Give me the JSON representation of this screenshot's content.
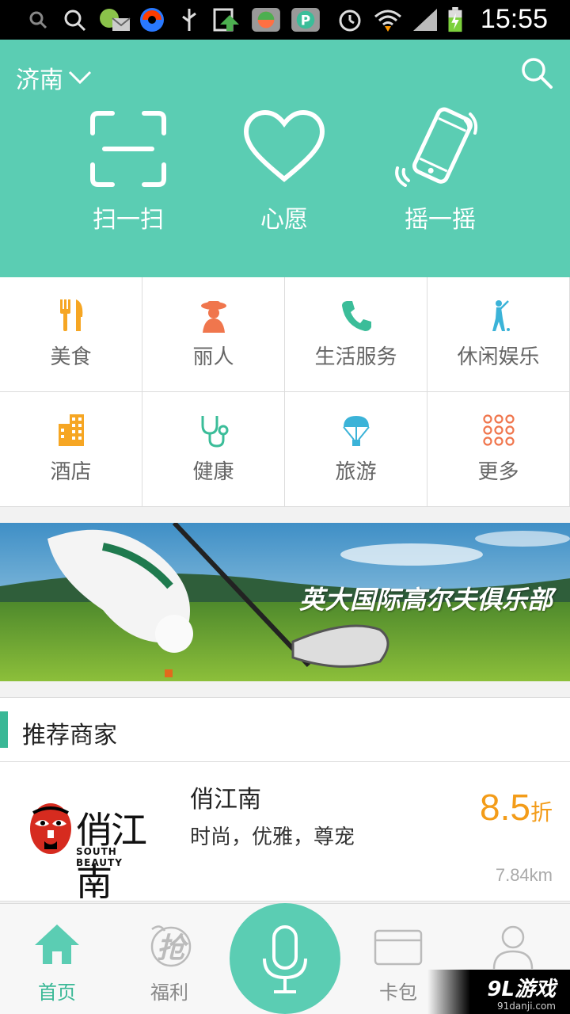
{
  "status_bar": {
    "time": "15:55",
    "icons": [
      "search-icon",
      "magnifier-icon",
      "mail-icon",
      "app-icon",
      "usb-icon",
      "upload-icon",
      "app-icon",
      "p-app-icon",
      "alarm-icon",
      "wifi-icon",
      "signal-icon",
      "battery-icon"
    ]
  },
  "header": {
    "city": "济南",
    "actions": [
      {
        "label": "扫一扫",
        "icon": "scan-icon"
      },
      {
        "label": "心愿",
        "icon": "heart-icon"
      },
      {
        "label": "摇一摇",
        "icon": "shake-phone-icon"
      }
    ]
  },
  "categories": [
    {
      "label": "美食",
      "icon": "fork-knife-icon",
      "color": "#f6a623"
    },
    {
      "label": "丽人",
      "icon": "lady-icon",
      "color": "#f0764d"
    },
    {
      "label": "生活服务",
      "icon": "phone-icon",
      "color": "#3bbd99"
    },
    {
      "label": "休闲娱乐",
      "icon": "golfer-icon",
      "color": "#3bb3d8"
    },
    {
      "label": "酒店",
      "icon": "building-icon",
      "color": "#f6a623"
    },
    {
      "label": "健康",
      "icon": "stethoscope-icon",
      "color": "#3bbd99"
    },
    {
      "label": "旅游",
      "icon": "balloon-icon",
      "color": "#3bb3d8"
    },
    {
      "label": "更多",
      "icon": "more-dots-icon",
      "color": "#f0764d"
    }
  ],
  "banner": {
    "title": "英大国际高尔夫俱乐部"
  },
  "section": {
    "title": "推荐商家"
  },
  "merchant": {
    "name": "俏江南",
    "desc": "时尚，优雅，尊宠",
    "discount": "8.5",
    "discount_unit": "折",
    "distance": "7.84km",
    "logo_text": "俏江南",
    "logo_sub": "SOUTH BEAUTY"
  },
  "nav": {
    "items": [
      {
        "label": "首页",
        "icon": "home-icon",
        "active": true
      },
      {
        "label": "福利",
        "icon": "welfare-icon",
        "active": false
      },
      {
        "label": "卡包",
        "icon": "card-icon",
        "active": false
      },
      {
        "label": "",
        "icon": "profile-icon",
        "active": false
      }
    ],
    "mic_icon": "microphone-icon"
  },
  "watermark": {
    "main": "9L游戏",
    "sub": "91danji.com"
  },
  "colors": {
    "accent": "#5bcdb3",
    "accent_dark": "#3ab896",
    "discount": "#f39c19"
  }
}
